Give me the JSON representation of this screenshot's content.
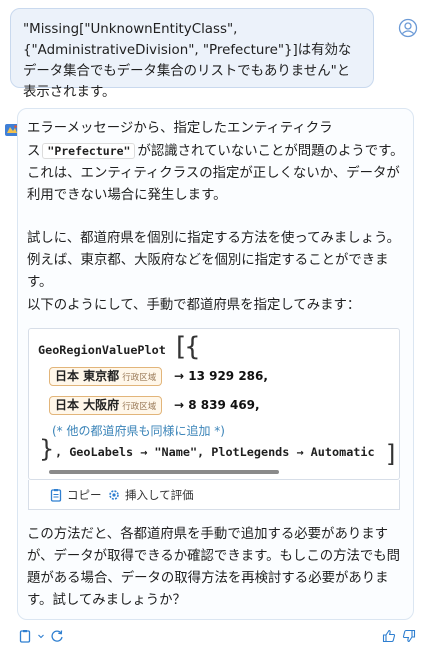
{
  "user_message": {
    "text": "\"Missing[\"UnknownEntityClass\",{\"AdministrativeDivision\", \"Prefecture\"}]は有効なデータ集合でもデータ集合のリストでもありません\"と表示されます。"
  },
  "assistant": {
    "para1_before": "エラーメッセージから、指定したエンティティクラス",
    "para1_code": "\"Prefecture\"",
    "para1_after": "が認識されていないことが問題のようです。これは、エンティティクラスの指定が正しくないか、データが利用できない場合に発生します。",
    "para2": "試しに、都道府県を個別に指定する方法を使ってみましょう。例えば、東京都、大阪府などを個別に指定することができます。",
    "para3": "以下のようにして、手動で都道府県を指定してみます：",
    "para4": "この方法だと、各都道府県を手動で追加する必要がありますが、データが取得できるか確認できます。もしこの方法でも問題がある場合、データの取得方法を再検討する必要があります。試してみましょうか？"
  },
  "code_cell": {
    "function": "GeoRegionValuePlot",
    "open_bracket": "[{",
    "entries": [
      {
        "name": "日本 東京都",
        "type": "行政区域",
        "value": "→ 13 929 286,"
      },
      {
        "name": "日本 大阪府",
        "type": "行政区域",
        "value": "→ 8 839 469,"
      }
    ],
    "comment": "(* 他の都道府県も同様に追加 *)",
    "close_brace": "}",
    "close_line": ", GeoLabels → \"Name\", PlotLegends → Automatic",
    "close_bracket": "]"
  },
  "actions": {
    "copy_label": "コピー",
    "insert_label": "挿入して評価"
  },
  "colors": {
    "user_bubble_bg": "#ecf2fa",
    "entity_border": "#e2b57a",
    "comment": "#3b84b8",
    "accent_blue": "#2f7fd0"
  }
}
